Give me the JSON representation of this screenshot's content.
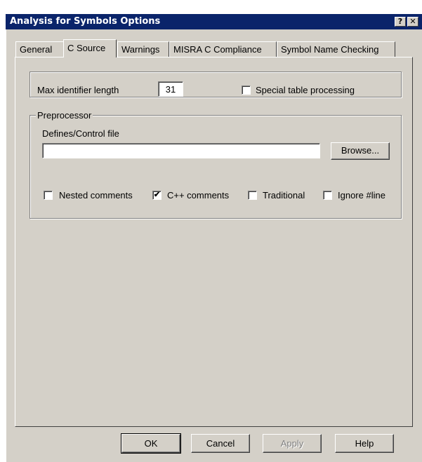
{
  "window": {
    "title": "Analysis for Symbols Options",
    "help_glyph": "?",
    "close_glyph": "✕"
  },
  "tabs": [
    {
      "label": "General"
    },
    {
      "label": "C Source"
    },
    {
      "label": "Warnings"
    },
    {
      "label": "MISRA C Compliance"
    },
    {
      "label": "Symbol Name Checking"
    }
  ],
  "active_tab": "C Source",
  "max_identifier": {
    "label": "Max identifier length",
    "value": "31"
  },
  "special_table": {
    "label": "Special table processing",
    "checked": false
  },
  "preprocessor": {
    "group_label": "Preprocessor",
    "defines_label": "Defines/Control file",
    "defines_value": "",
    "browse_label": "Browse...",
    "options": [
      {
        "label": "Nested comments",
        "checked": false
      },
      {
        "label": "C++ comments",
        "checked": true
      },
      {
        "label": "Traditional",
        "checked": false
      },
      {
        "label": "Ignore #line",
        "checked": false
      }
    ]
  },
  "buttons": {
    "ok": "OK",
    "cancel": "Cancel",
    "apply": "Apply",
    "help": "Help"
  },
  "check_glyph": "✔"
}
